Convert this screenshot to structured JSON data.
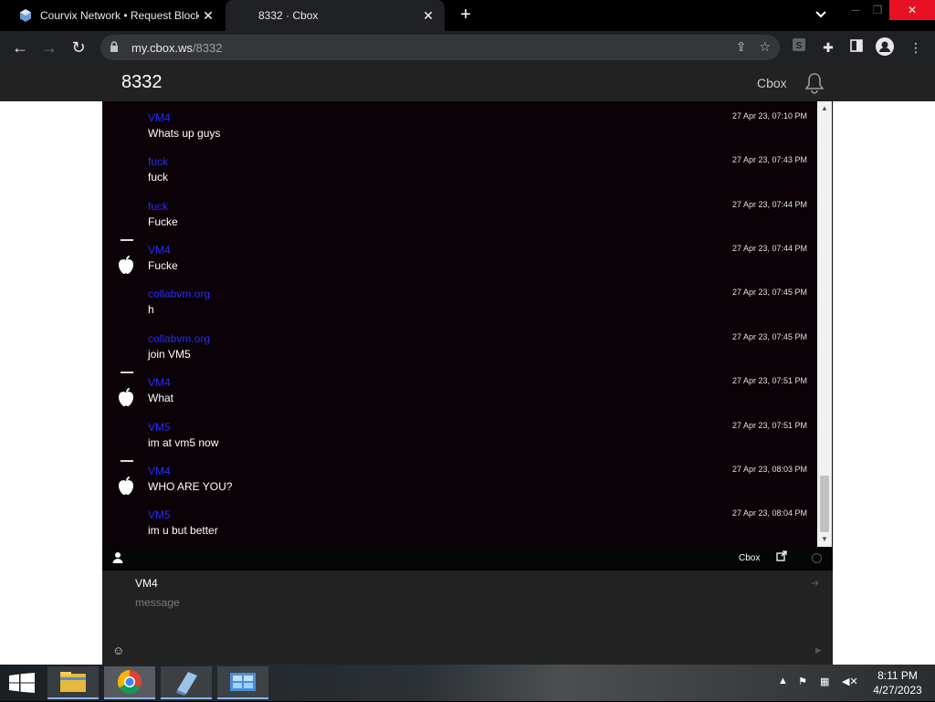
{
  "browser": {
    "tabs": [
      {
        "title": "Courvix Network • Request Block",
        "active": false
      },
      {
        "title": "8332 · Cbox",
        "active": true
      }
    ],
    "url_host": "my.cbox.ws",
    "url_path": "/8332"
  },
  "site": {
    "title": "8332",
    "brand": "Cbox"
  },
  "messages": [
    {
      "name": "VM4",
      "text": "Whats up guys",
      "time": "27 Apr 23, 07:10 PM",
      "avatar": false
    },
    {
      "name": "fuck",
      "text": "fuck",
      "time": "27 Apr 23, 07:43 PM",
      "avatar": false
    },
    {
      "name": "fuck",
      "text": "Fucke",
      "time": "27 Apr 23, 07:44 PM",
      "avatar": false
    },
    {
      "name": "VM4",
      "text": "Fucke",
      "time": "27 Apr 23, 07:44 PM",
      "avatar": true
    },
    {
      "name": "collabvm.org",
      "text": "h",
      "time": "27 Apr 23, 07:45 PM",
      "avatar": false
    },
    {
      "name": "collabvm.org",
      "text": "join VM5",
      "time": "27 Apr 23, 07:45 PM",
      "avatar": false
    },
    {
      "name": "VM4",
      "text": "What",
      "time": "27 Apr 23, 07:51 PM",
      "avatar": true
    },
    {
      "name": "VM5",
      "text": "im at vm5 now",
      "time": "27 Apr 23, 07:51 PM",
      "avatar": false
    },
    {
      "name": "VM4",
      "text": "WHO ARE YOU?",
      "time": "27 Apr 23, 08:03 PM",
      "avatar": true
    },
    {
      "name": "VM5",
      "text": "im u but better",
      "time": "27 Apr 23, 08:04 PM",
      "avatar": false
    }
  ],
  "chatbar": {
    "brand": "Cbox"
  },
  "compose": {
    "nick": "VM4",
    "placeholder": "message"
  },
  "taskbar": {
    "time": "8:11 PM",
    "date": "4/27/2023"
  }
}
